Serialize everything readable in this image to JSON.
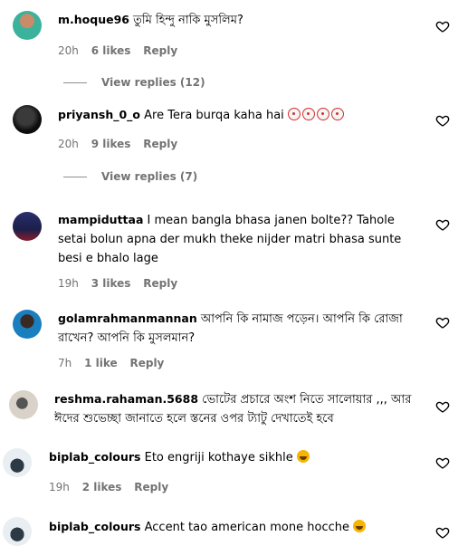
{
  "comments": [
    {
      "username": "m.hoque96",
      "text": "তুমি হিন্দু নাকি মুসলিম?",
      "time": "20h",
      "likes": "6 likes",
      "reply": "Reply",
      "view_replies": "View replies (12)"
    },
    {
      "username": "priyansh_0_o",
      "text": "Are Tera burqa kaha hai",
      "emoji": [
        "clown-face",
        "clown-face",
        "clown-face",
        "clown-face"
      ],
      "time": "20h",
      "likes": "9 likes",
      "reply": "Reply",
      "view_replies": "View replies (7)"
    },
    {
      "username": "mampiduttaa",
      "text": "I mean bangla bhasa janen bolte?? Tahole setai bolun apna der mukh theke nijder matri bhasa sunte besi e bhalo lage",
      "time": "19h",
      "likes": "3 likes",
      "reply": "Reply"
    },
    {
      "username": "golamrahmanmannan",
      "text": "আপনি কি নামাজ পড়েন। আপনি কি রোজা রাখেন? আপনি কি মুসলমান?",
      "time": "7h",
      "likes": "1 like",
      "reply": "Reply"
    },
    {
      "username": "reshma.rahaman.5688",
      "text": "ভোটের প্রচারে অংশ নিতে সালোয়ার ,,, আর ঈদের শুভেচ্ছা জানাতে হলে স্তনের ওপর ট্যাটু দেখাতেই হবে"
    },
    {
      "username": "biplab_colours",
      "text": "Eto engriji kothaye sikhle",
      "emoji": [
        "laughing-tears"
      ],
      "time": "19h",
      "likes": "2 likes",
      "reply": "Reply"
    },
    {
      "username": "biplab_colours",
      "text": "Accent tao american mone hocche",
      "emoji": [
        "laughing-tears"
      ]
    }
  ],
  "colors": {
    "muted": "#737373",
    "clown": "#d32f2f",
    "laugh": "#f7b500"
  }
}
